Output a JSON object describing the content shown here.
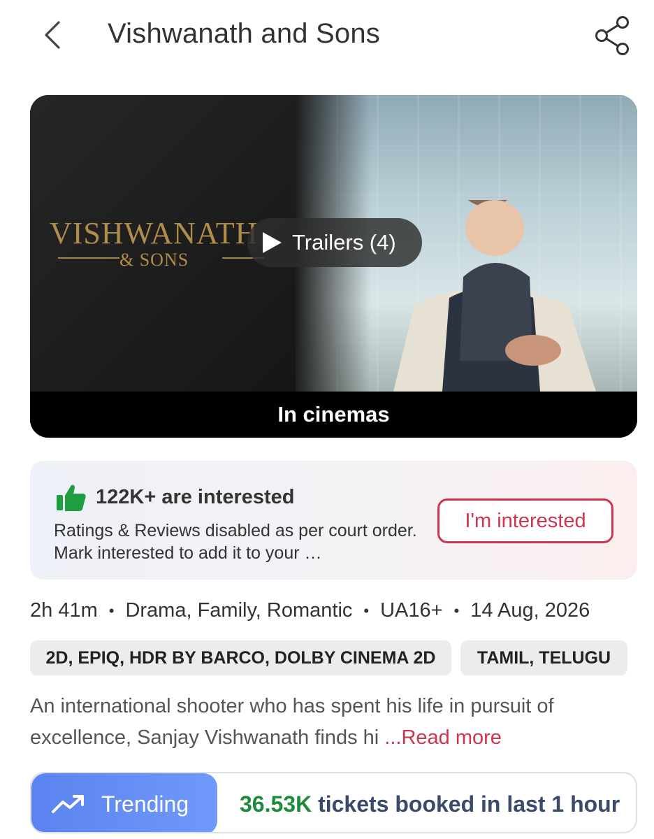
{
  "header": {
    "title": "Vishwanath and Sons"
  },
  "banner": {
    "logo_main": "VISHWANATH",
    "logo_sub": "& SONS",
    "trailer_label": "Trailers (4)",
    "status": "In cinemas"
  },
  "interest": {
    "count_text": "122K+ are interested",
    "description": "Ratings & Reviews disabled as per court order. Mark interested to add it to your …",
    "button_label": "I'm interested"
  },
  "meta": {
    "duration": "2h 41m",
    "genres": "Drama, Family, Romantic",
    "certificate": "UA16+",
    "release_date": "14 Aug, 2026"
  },
  "tags": {
    "formats": "2D, EPIQ, HDR BY BARCO, DOLBY CINEMA 2D",
    "languages": "TAMIL, TELUGU"
  },
  "synopsis": {
    "text": "An international shooter who has spent his life in pursuit of excellence, Sanjay Vishwanath finds hi",
    "read_more": "...Read more"
  },
  "trending": {
    "label": "Trending",
    "count": "36.53K",
    "suffix": " tickets booked in last 1 hour"
  },
  "colors": {
    "accent": "#d0344f",
    "trending_blue": "#5a83f0",
    "green": "#1e8a3a"
  },
  "icons": [
    "back-arrow-icon",
    "share-icon",
    "play-icon",
    "thumbs-up-icon",
    "trending-up-icon"
  ]
}
